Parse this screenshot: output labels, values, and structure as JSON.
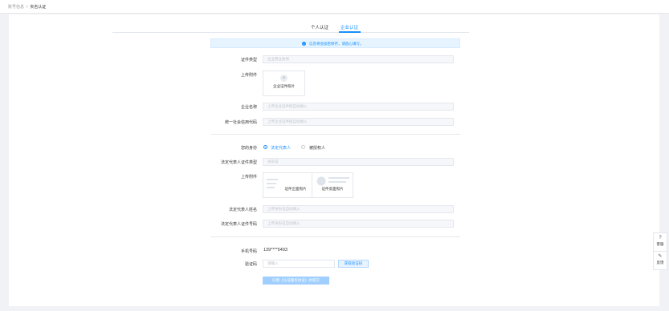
{
  "breadcrumb": {
    "parent": "账号信息",
    "separator": "/",
    "current": "实名认证"
  },
  "tabs": [
    {
      "label": "个人认证"
    },
    {
      "label": "企业认证"
    }
  ],
  "notice": {
    "text": "信息将会加密保存，请放心填写。"
  },
  "form": {
    "doc_type": {
      "label": "证件类型",
      "placeholder": "企业营业执照"
    },
    "attachment": {
      "label": "上传附件",
      "caption": "企业证件照片"
    },
    "company_name": {
      "label": "企业名称",
      "placeholder": "上传企业证件照自动填入"
    },
    "credit_code": {
      "label": "统一社会信用代码",
      "placeholder": "上传企业证件照自动填入"
    },
    "identity": {
      "label": "您的身份",
      "options": [
        "法定代表人",
        "被授权人"
      ],
      "selected": "法定代表人"
    },
    "legal_doc_type": {
      "label": "法定代表人证件类型",
      "placeholder": "身份证"
    },
    "legal_attachment": {
      "label": "上传附件",
      "front_caption": "证件正面照片",
      "back_caption": "证件反面照片"
    },
    "legal_name": {
      "label": "法定代表人姓名",
      "placeholder": "上传身份证自动填入"
    },
    "legal_id": {
      "label": "法定代表人证件号码",
      "placeholder": "上传身份证自动填入"
    },
    "phone": {
      "label": "手机号码",
      "value": "139****5493"
    },
    "code": {
      "label": "验证码",
      "placeholder": "请输入",
      "button": "获取验证码"
    },
    "submit": {
      "label": "同意《认证服务协议》并提交"
    }
  },
  "side_buttons": [
    {
      "icon": "question-icon",
      "glyph": "?",
      "label": "客服"
    },
    {
      "icon": "edit-icon",
      "glyph": "✎",
      "label": "反馈"
    }
  ],
  "colors": {
    "accent": "#1890ff",
    "notice_bg": "#e6f4ff",
    "disabled_btn": "#a0cfff"
  }
}
